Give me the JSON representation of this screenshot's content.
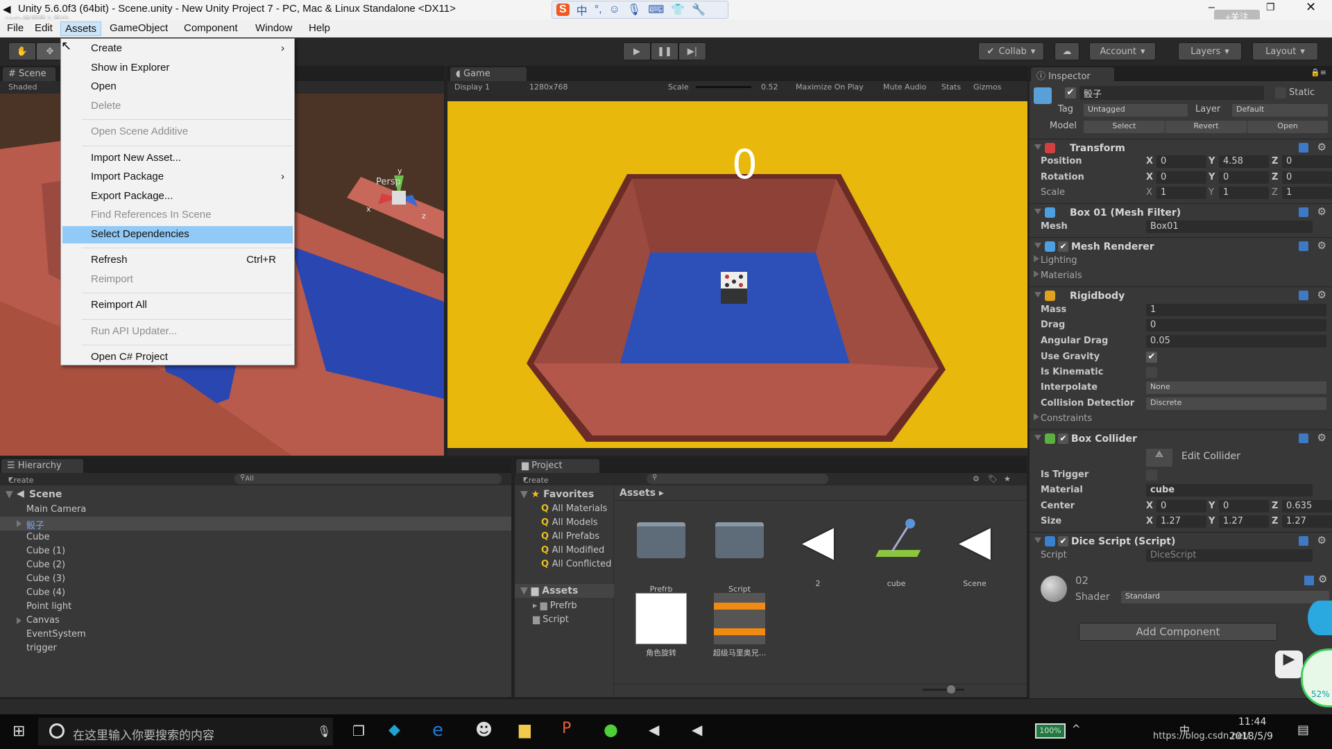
{
  "window": {
    "title": "Unity 5.6.0f3 (64bit) - Scene.unity - New Unity Project 7 - PC, Mac & Linux Standalone <DX11>",
    "watermark": "Unity资源导入导出",
    "ime_label": "中",
    "follow_button": "+关注"
  },
  "menubar": {
    "items": [
      "File",
      "Edit",
      "Assets",
      "GameObject",
      "Component",
      "Window",
      "Help"
    ],
    "active": "Assets"
  },
  "assets_menu": {
    "items": [
      {
        "label": "Create",
        "submenu": true
      },
      {
        "label": "Show in Explorer"
      },
      {
        "label": "Open"
      },
      {
        "label": "Delete",
        "disabled": true
      },
      {
        "label": "Open Scene Additive",
        "disabled": true,
        "sep_before": true
      },
      {
        "label": "Import New Asset...",
        "sep_before": true
      },
      {
        "label": "Import Package",
        "submenu": true
      },
      {
        "label": "Export Package..."
      },
      {
        "label": "Find References In Scene",
        "disabled": true
      },
      {
        "label": "Select Dependencies",
        "highlighted": true
      },
      {
        "label": "Refresh",
        "shortcut": "Ctrl+R",
        "sep_before": true
      },
      {
        "label": "Reimport",
        "disabled": true
      },
      {
        "label": "Reimport All",
        "sep_before": true
      },
      {
        "label": "Run API Updater...",
        "disabled": true,
        "sep_before": true
      },
      {
        "label": "Open C# Project",
        "sep_before": true
      }
    ]
  },
  "toolbar": {
    "collab": "Collab",
    "account": "Account",
    "layers": "Layers",
    "layout": "Layout"
  },
  "scene": {
    "tab": "Scene",
    "shading": "Shaded",
    "persp": "Persp",
    "axis_y": "y",
    "axis_x": "x",
    "axis_z": "z"
  },
  "game": {
    "tab": "Game",
    "display": "Display 1",
    "resolution": "1280x768",
    "scale_label": "Scale",
    "scale_value": "0.52",
    "maximize": "Maximize On Play",
    "mute": "Mute Audio",
    "stats": "Stats",
    "gizmos": "Gizmos",
    "score": "0",
    "background_color": "#e8b90c"
  },
  "inspector": {
    "tab": "Inspector",
    "object_name": "骰子",
    "static_label": "Static",
    "tag_label": "Tag",
    "tag": "Untagged",
    "layer_label": "Layer",
    "layer": "Default",
    "model_label": "Model",
    "select": "Select",
    "revert": "Revert",
    "open": "Open",
    "transform": {
      "title": "Transform",
      "position": {
        "label": "Position",
        "x": "0",
        "y": "4.58",
        "z": "0"
      },
      "rotation": {
        "label": "Rotation",
        "x": "0",
        "y": "0",
        "z": "0"
      },
      "scale": {
        "label": "Scale",
        "x": "1",
        "y": "1",
        "z": "1"
      }
    },
    "mesh_filter": {
      "title": "Box 01 (Mesh Filter)",
      "mesh_label": "Mesh",
      "mesh": "Box01"
    },
    "mesh_renderer": {
      "title": "Mesh Renderer",
      "enabled": true,
      "lighting": "Lighting",
      "materials": "Materials"
    },
    "rigidbody": {
      "title": "Rigidbody",
      "mass_label": "Mass",
      "mass": "1",
      "drag_label": "Drag",
      "drag": "0",
      "angular_drag_label": "Angular Drag",
      "angular_drag": "0.05",
      "use_gravity_label": "Use Gravity",
      "use_gravity": true,
      "is_kinematic_label": "Is Kinematic",
      "is_kinematic": false,
      "interpolate_label": "Interpolate",
      "interpolate": "None",
      "collision_label": "Collision Detectior",
      "collision": "Discrete",
      "constraints": "Constraints"
    },
    "box_collider": {
      "title": "Box Collider",
      "enabled": true,
      "edit_collider": "Edit Collider",
      "is_trigger_label": "Is Trigger",
      "is_trigger": false,
      "material_label": "Material",
      "material": "cube",
      "center": {
        "label": "Center",
        "x": "0",
        "y": "0",
        "z": "0.635"
      },
      "size": {
        "label": "Size",
        "x": "1.27",
        "y": "1.27",
        "z": "1.27"
      }
    },
    "dice_script": {
      "title": "Dice Script (Script)",
      "enabled": true,
      "script_label": "Script",
      "script": "DiceScript"
    },
    "material": {
      "name": "02",
      "shader_label": "Shader",
      "shader": "Standard"
    },
    "add_component": "Add Component"
  },
  "hierarchy": {
    "tab": "Hierarchy",
    "create": "Create",
    "search_placeholder": "All",
    "scene": "Scene",
    "items": [
      {
        "label": "Main Camera"
      },
      {
        "label": "骰子",
        "expandable": true,
        "selected": true
      },
      {
        "label": "Cube"
      },
      {
        "label": "Cube (1)"
      },
      {
        "label": "Cube (2)"
      },
      {
        "label": "Cube (3)"
      },
      {
        "label": "Cube (4)"
      },
      {
        "label": "Point light"
      },
      {
        "label": "Canvas",
        "expandable": true
      },
      {
        "label": "EventSystem"
      },
      {
        "label": "trigger"
      }
    ]
  },
  "project": {
    "tab": "Project",
    "create": "Create",
    "favorites_label": "Favorites",
    "favorites": [
      "All Materials",
      "All Models",
      "All Prefabs",
      "All Modified",
      "All Conflicted"
    ],
    "assets_label": "Assets",
    "tree": [
      "Prefrb",
      "Script"
    ],
    "breadcrumb": "Assets",
    "assets": [
      {
        "label": "Prefrb",
        "icon": "folder"
      },
      {
        "label": "Script",
        "icon": "folder"
      },
      {
        "label": "2",
        "icon": "unity-scene"
      },
      {
        "label": "cube",
        "icon": "physic-material"
      },
      {
        "label": "Scene",
        "icon": "unity-scene"
      },
      {
        "label": "角色旋转",
        "icon": "image-thumbnail"
      },
      {
        "label": "超级马里奥兄...",
        "icon": "audio-clip"
      }
    ]
  },
  "taskbar": {
    "search_placeholder": "在这里输入你要搜索的内容",
    "battery": "100%",
    "time": "11:44",
    "date": "2018/5/9",
    "url_overlay": "https://blog.csdn.net/",
    "ime": "中",
    "overlay_percent": "52%"
  }
}
